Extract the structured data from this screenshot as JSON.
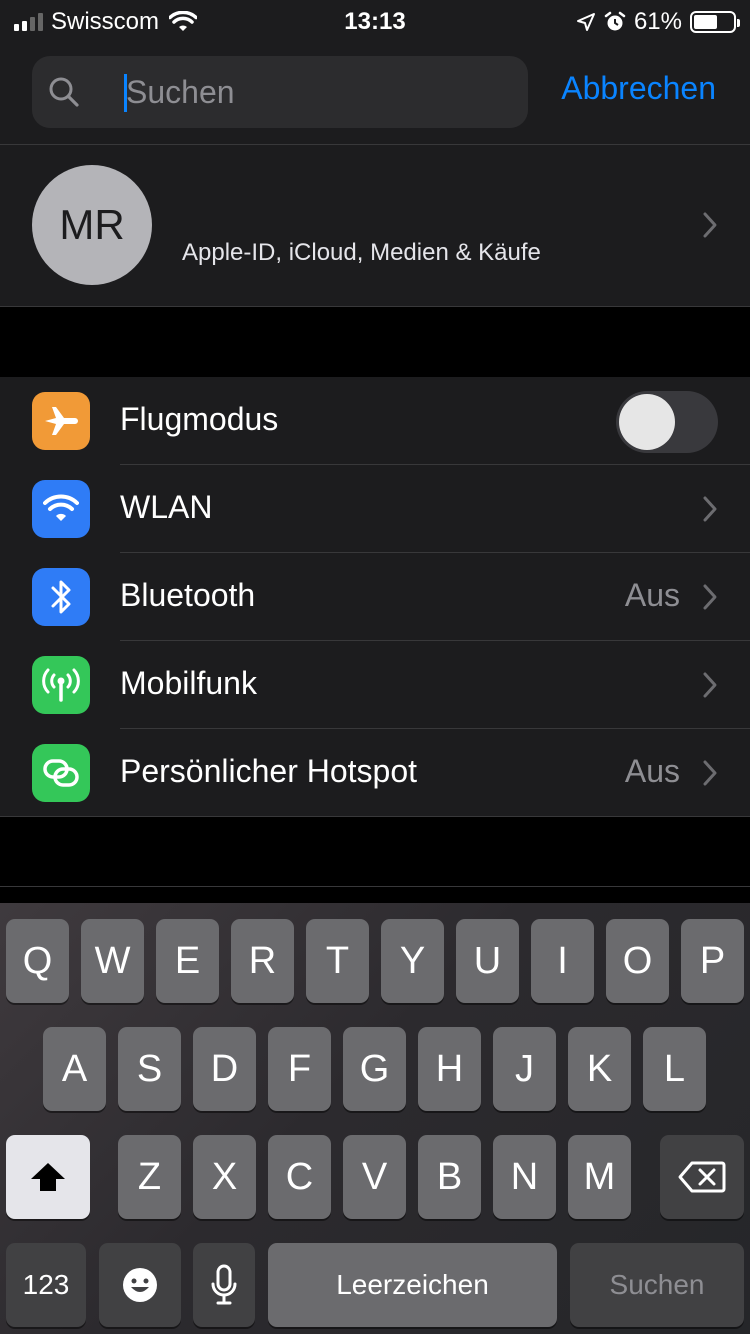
{
  "status_bar": {
    "carrier": "Swisscom",
    "time": "13:13",
    "battery": "61%",
    "battery_level": 0.61
  },
  "search": {
    "placeholder": "Suchen",
    "value": "",
    "cancel_label": "Abbrechen"
  },
  "profile": {
    "initials": "MR",
    "subtitle": "Apple-ID, iCloud, Medien & Käufe"
  },
  "settings": [
    {
      "label": "Flugmodus",
      "icon": "airplane-icon",
      "color": "#f19a37",
      "toggle": false
    },
    {
      "label": "WLAN",
      "icon": "wifi-icon",
      "color": "#2f7cf6",
      "value": ""
    },
    {
      "label": "Bluetooth",
      "icon": "bluetooth-icon",
      "color": "#2f7cf6",
      "value": "Aus"
    },
    {
      "label": "Mobilfunk",
      "icon": "antenna-icon",
      "color": "#34c759",
      "value": ""
    },
    {
      "label": "Persönlicher Hotspot",
      "icon": "hotspot-icon",
      "color": "#34c759",
      "value": "Aus"
    }
  ],
  "keyboard": {
    "row1": [
      "Q",
      "W",
      "E",
      "R",
      "T",
      "Y",
      "U",
      "I",
      "O",
      "P"
    ],
    "row2": [
      "A",
      "S",
      "D",
      "F",
      "G",
      "H",
      "J",
      "K",
      "L"
    ],
    "row3": [
      "Z",
      "X",
      "C",
      "V",
      "B",
      "N",
      "M"
    ],
    "numbers_label": "123",
    "space_label": "Leerzeichen",
    "search_label": "Suchen"
  },
  "colors": {
    "accent": "#0a84ff",
    "background": "#000000",
    "cell": "#1c1c1e"
  }
}
